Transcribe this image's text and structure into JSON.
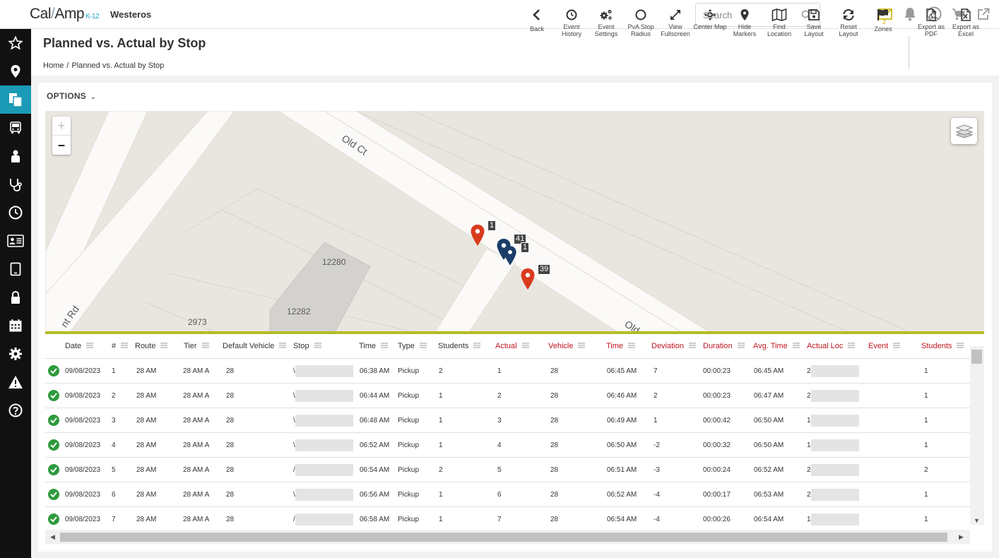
{
  "app": {
    "logo_left": "Cal",
    "logo_right": "Amp",
    "logo_suffix": "K-12",
    "tenant": "Westeros",
    "search_placeholder": "Search",
    "mail_count": "2"
  },
  "page": {
    "title": "Planned vs. Actual by Stop",
    "breadcrumb": [
      "Home",
      "/",
      "Planned vs. Actual by Stop"
    ]
  },
  "toolbar": [
    {
      "label": "Back",
      "icon": "chevron-left-icon"
    },
    {
      "label": "Event History",
      "icon": "clock-icon"
    },
    {
      "label": "Event Settings",
      "icon": "gears-icon"
    },
    {
      "label": "PvA Stop Radius",
      "icon": "circle-icon"
    },
    {
      "label": "View Fullscreen",
      "icon": "expand-icon"
    },
    {
      "label": "Center Map",
      "icon": "crosshair-icon"
    },
    {
      "label": "Hide Markers",
      "icon": "map-pin-icon"
    },
    {
      "label": "Find Location",
      "icon": "map-icon"
    },
    {
      "label": "Save Layout",
      "icon": "floppy-icon"
    },
    {
      "label": "Reset Layout",
      "icon": "refresh-icon"
    },
    {
      "label": "Zones",
      "icon": "flag-icon"
    },
    {
      "label": "Export as PDF",
      "icon": "pdf-icon"
    },
    {
      "label": "Export as Excel",
      "icon": "excel-icon"
    }
  ],
  "options_label": "OPTIONS",
  "map": {
    "streets": [
      "Old Ct",
      "Old",
      "nt Rd"
    ],
    "parcels": [
      "12280",
      "12282",
      "2973"
    ],
    "marker_tags": [
      "1",
      "41",
      "1",
      "39"
    ],
    "colors": {
      "planned": "#d93a1d",
      "actual": "#1b3d66"
    }
  },
  "table": {
    "columns": [
      {
        "label": "Date",
        "highlight": false
      },
      {
        "label": "#",
        "highlight": false
      },
      {
        "label": "Route",
        "highlight": false
      },
      {
        "label": "Tier",
        "highlight": false
      },
      {
        "label": "Default Vehicle",
        "highlight": false
      },
      {
        "label": "Stop",
        "highlight": false
      },
      {
        "label": "Time",
        "highlight": false
      },
      {
        "label": "Type",
        "highlight": false
      },
      {
        "label": "Students",
        "highlight": false
      },
      {
        "label": "Actual",
        "highlight": true
      },
      {
        "label": "Vehicle",
        "highlight": true
      },
      {
        "label": "Time",
        "highlight": true
      },
      {
        "label": "Deviation",
        "highlight": true
      },
      {
        "label": "Duration",
        "highlight": true
      },
      {
        "label": "Avg. Time",
        "highlight": true
      },
      {
        "label": "Actual Loc",
        "highlight": true
      },
      {
        "label": "Event",
        "highlight": true
      },
      {
        "label": "Students",
        "highlight": true
      }
    ],
    "rows": [
      {
        "date": "09/08/2023",
        "num": "1",
        "route": "28 AM",
        "tier": "28 AM  A",
        "vehicle": "28",
        "stop": "\\",
        "time": "06:38 AM",
        "type": "Pickup",
        "students": "2",
        "actual": "1",
        "act_vehicle": "28",
        "act_time": "06:45 AM",
        "deviation": "7",
        "duration": "00:00:23",
        "avg_time": "06:45 AM",
        "act_loc": "2",
        "event": "",
        "act_students": "1"
      },
      {
        "date": "09/08/2023",
        "num": "2",
        "route": "28 AM",
        "tier": "28 AM  A",
        "vehicle": "28",
        "stop": "\\",
        "time": "06:44 AM",
        "type": "Pickup",
        "students": "1",
        "actual": "2",
        "act_vehicle": "28",
        "act_time": "06:46 AM",
        "deviation": "2",
        "duration": "00:00:23",
        "avg_time": "06:47 AM",
        "act_loc": "2",
        "event": "",
        "act_students": "1"
      },
      {
        "date": "09/08/2023",
        "num": "3",
        "route": "28 AM",
        "tier": "28 AM  A",
        "vehicle": "28",
        "stop": "\\",
        "time": "06:48 AM",
        "type": "Pickup",
        "students": "1",
        "actual": "3",
        "act_vehicle": "28",
        "act_time": "06:49 AM",
        "deviation": "1",
        "duration": "00:00:42",
        "avg_time": "06:50 AM",
        "act_loc": "1",
        "event": "",
        "act_students": "1"
      },
      {
        "date": "09/08/2023",
        "num": "4",
        "route": "28 AM",
        "tier": "28 AM  A",
        "vehicle": "28",
        "stop": "\\",
        "time": "06:52 AM",
        "type": "Pickup",
        "students": "1",
        "actual": "4",
        "act_vehicle": "28",
        "act_time": "06:50 AM",
        "deviation": "-2",
        "duration": "00:00:32",
        "avg_time": "06:50 AM",
        "act_loc": "1",
        "event": "",
        "act_students": "1"
      },
      {
        "date": "09/08/2023",
        "num": "5",
        "route": "28 AM",
        "tier": "28 AM  A",
        "vehicle": "28",
        "stop": "/",
        "time": "06:54 AM",
        "type": "Pickup",
        "students": "2",
        "actual": "5",
        "act_vehicle": "28",
        "act_time": "06:51 AM",
        "deviation": "-3",
        "duration": "00:00:24",
        "avg_time": "06:52 AM",
        "act_loc": "2",
        "event": "",
        "act_students": "2"
      },
      {
        "date": "09/08/2023",
        "num": "6",
        "route": "28 AM",
        "tier": "28 AM  A",
        "vehicle": "28",
        "stop": "\\",
        "time": "06:56 AM",
        "type": "Pickup",
        "students": "1",
        "actual": "6",
        "act_vehicle": "28",
        "act_time": "06:52 AM",
        "deviation": "-4",
        "duration": "00:00:17",
        "avg_time": "06:53 AM",
        "act_loc": "2",
        "event": "",
        "act_students": "1"
      },
      {
        "date": "09/08/2023",
        "num": "7",
        "route": "28 AM",
        "tier": "28 AM  A",
        "vehicle": "28",
        "stop": "/",
        "time": "06:58 AM",
        "type": "Pickup",
        "students": "1",
        "actual": "7",
        "act_vehicle": "28",
        "act_time": "06:54 AM",
        "deviation": "-4",
        "duration": "00:00:26",
        "avg_time": "06:54 AM",
        "act_loc": "1",
        "event": "",
        "act_students": "1"
      }
    ]
  }
}
